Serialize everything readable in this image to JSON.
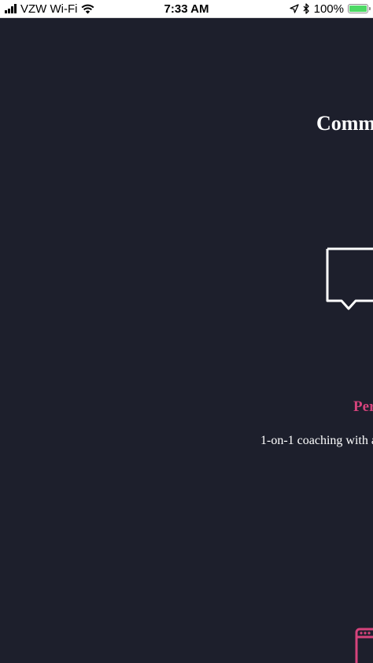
{
  "status_bar": {
    "carrier": "VZW Wi-Fi",
    "time": "7:33 AM",
    "battery_percent": "100%",
    "battery_level": 1.0,
    "signal_icon": "cellular-signal-icon",
    "wifi_icon": "wifi-icon",
    "location_icon": "location-arrow-icon",
    "bluetooth_icon": "bluetooth-icon"
  },
  "colors": {
    "background": "#1d1f2c",
    "accent": "#d6437c",
    "text": "#ffffff"
  },
  "main": {
    "heading": "Comm",
    "feature": {
      "icon": "chat-bubble-icon",
      "title": "Per",
      "description": "1-on-1 coaching with a"
    },
    "next_feature_icon": "browser-window-icon"
  }
}
